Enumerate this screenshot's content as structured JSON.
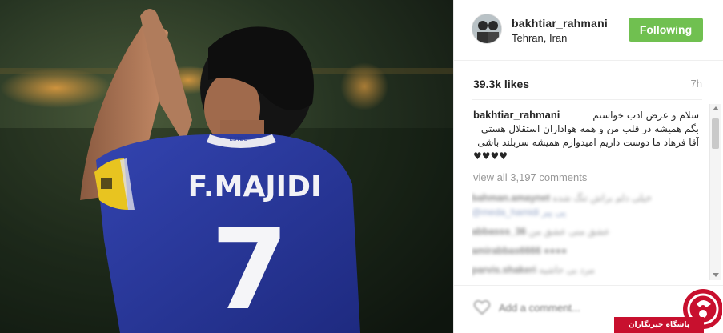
{
  "post": {
    "photo": {
      "jersey_name": "F.MAJIDI",
      "jersey_number": "7",
      "collar_text": "ESTEG"
    },
    "author": {
      "username": "bakhtiar_rahmani",
      "location": "Tehran, Iran"
    },
    "follow_label": "Following",
    "likes": "39.3k likes",
    "time": "7h",
    "caption": {
      "username": "bakhtiar_rahmani",
      "lines": [
        "سلام و عرض ادب خواستم",
        "بگم همیشه در قلب من و همه هواداران استقلال هستی",
        "آقا فرهاد ما دوست داریم امیدوارم همیشه سربلند باشی",
        "♥♥♥♥"
      ]
    },
    "view_all_comments": "view all 3,197 comments",
    "blurred_comments": [
      {
        "user": "bahman.amaynet",
        "text": "خیلی دلم براش تنگ شده"
      },
      {
        "user": "",
        "text": "@meda_hamidi پی پیر"
      },
      {
        "user": "abbasss_36",
        "text": "عشق منی عشق من"
      },
      {
        "user": "amirabbas6666",
        "text": "●●●●"
      },
      {
        "user": "parvis.shakeri",
        "text": "مرد بی حاشیه"
      }
    ],
    "comment_placeholder": "Add a comment..."
  },
  "watermark": {
    "text": "باشگاه خبرنگاران",
    "brand_color": "#c8102e"
  },
  "colors": {
    "follow_button": "#70c050",
    "jersey": "#2a3a9a"
  }
}
